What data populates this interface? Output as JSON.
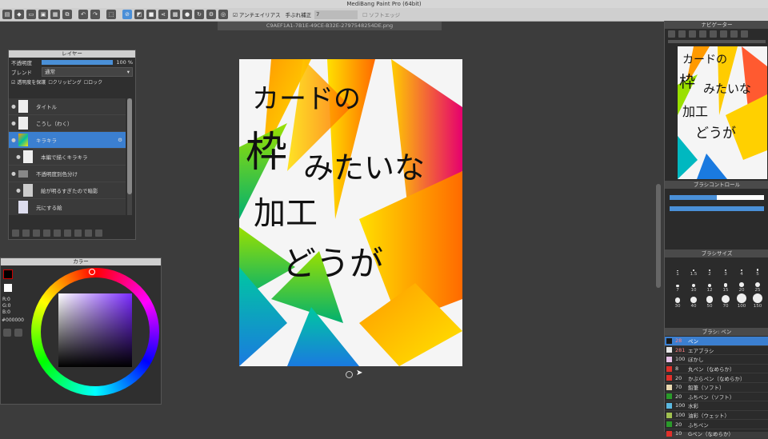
{
  "app": {
    "title": "MediBang Paint Pro (64bit)"
  },
  "toolbar": {
    "antialias_label": "アンチエイリアス",
    "stabilizer_label": "手ぶれ補正",
    "stabilizer_value": "7",
    "soft_edge_label": "ソフトエッジ"
  },
  "document": {
    "tab_name": "C9AEF1A1-7B1E-49CE-B32E-2797548254DE.png"
  },
  "canvas_text": {
    "line1": "カードの",
    "line2": "枠",
    "line3": "みたいな",
    "line4": "加工",
    "line5": "どうが"
  },
  "layer_panel": {
    "title": "レイヤー",
    "opacity_label": "不透明度",
    "opacity_value": "100 %",
    "opacity_fraction": 1.0,
    "blend_label": "ブレンド",
    "blend_value": "通常",
    "protect_label": "透明度を保護",
    "clipping_label": "クリッピング",
    "lock_label": "ロック",
    "layers": [
      {
        "name": "タイトル"
      },
      {
        "name": "こうし（わく）"
      },
      {
        "name": "キラキラ"
      },
      {
        "name": "本編で描くキラキラ"
      },
      {
        "name": "不透明度別色分け"
      },
      {
        "name": "絵が明るすぎたので暗影"
      },
      {
        "name": "元にする絵"
      }
    ]
  },
  "color_panel": {
    "title": "カラー",
    "r_label": "R:0",
    "g_label": "G:0",
    "b_label": "B:0",
    "hex_value": "#000000"
  },
  "navigator": {
    "title": "ナビゲーター"
  },
  "brush_control": {
    "title": "ブラシコントロール",
    "size_fraction": 0.5,
    "opacity_fraction": 1.0
  },
  "brush_size": {
    "title": "ブラシサイズ",
    "sizes": [
      "1",
      "1.5",
      "2",
      "3",
      "4",
      "5",
      "7",
      "10",
      "12",
      "15",
      "20",
      "25",
      "30",
      "40",
      "50",
      "70",
      "100",
      "150"
    ]
  },
  "brush_list": {
    "title": "ブラシ: ペン",
    "items": [
      {
        "size": "28",
        "name": "ペン",
        "color": "#1a1a1a"
      },
      {
        "size": "281",
        "name": "エアブラシ",
        "color": "#e6e6e6"
      },
      {
        "size": "100",
        "name": "ぼかし",
        "color": "#e6c0e6"
      },
      {
        "size": "8",
        "name": "丸ペン（なめらか）",
        "color": "#e0302a"
      },
      {
        "size": "20",
        "name": "かぶらペン（なめらか）",
        "color": "#e0302a"
      },
      {
        "size": "70",
        "name": "鉛筆（ソフト）",
        "color": "#e8d8b0"
      },
      {
        "size": "20",
        "name": "ふちペン（ソフト）",
        "color": "#2a9a2a"
      },
      {
        "size": "100",
        "name": "水彩",
        "color": "#5ab8e0"
      },
      {
        "size": "100",
        "name": "油彩（ウェット）",
        "color": "#a0c050"
      },
      {
        "size": "20",
        "name": "ふちペン",
        "color": "#2a9a2a"
      },
      {
        "size": "10",
        "name": "Gペン（なめらか）",
        "color": "#e0302a"
      }
    ]
  },
  "colors": {
    "accent": "#3b7fd0"
  }
}
